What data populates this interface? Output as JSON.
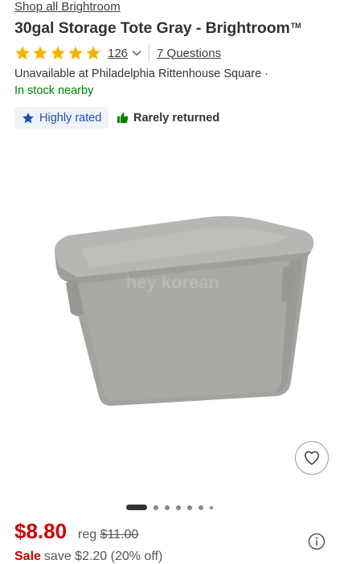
{
  "breadcrumb": {
    "shop_link": "Shop all Brightroom"
  },
  "product": {
    "title": "30gal Storage Tote Gray - Brightroom",
    "trademark": "TM",
    "rating_stars": 5,
    "review_count": "126",
    "questions_label": "7 Questions"
  },
  "fulfillment": {
    "availability": "Unavailable at Philadelphia Rittenhouse Square ·",
    "stock_status": "In stock nearby"
  },
  "badges": {
    "highly_rated": "Highly rated",
    "rarely_returned": "Rarely returned"
  },
  "image": {
    "watermark": "hey korean",
    "carousel_count": 7,
    "carousel_active_index": 0
  },
  "pricing": {
    "price": "$8.80",
    "reg_prefix": "reg",
    "reg_price": "$11.00",
    "sale_label": "Sale",
    "savings": "save $2.20 (20% off)"
  },
  "colors": {
    "price_red": "#cc0000",
    "stock_green": "#008300",
    "star_gold": "#f5b301",
    "badge_blue": "#1f4fa8"
  },
  "icons": {
    "star": "star-icon",
    "chevron": "chevron-down-icon",
    "highly_rated": "star-icon",
    "rarely_returned": "thumbs-up-icon",
    "favorite": "heart-icon",
    "info": "info-icon"
  }
}
